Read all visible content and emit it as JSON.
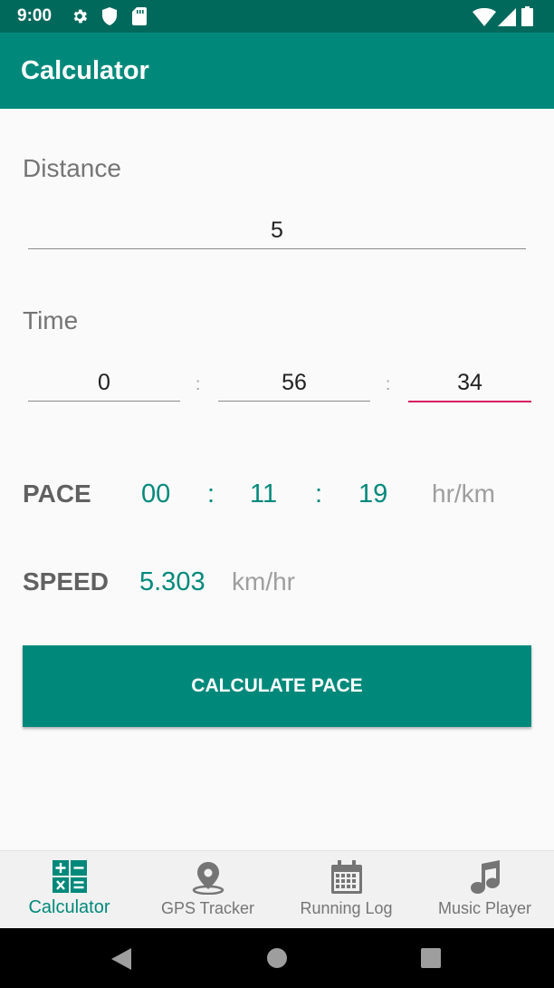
{
  "status_bar": {
    "time": "9:00"
  },
  "app_bar": {
    "title": "Calculator"
  },
  "distance": {
    "label": "Distance",
    "value": "5"
  },
  "time": {
    "label": "Time",
    "hours": "0",
    "minutes": "56",
    "seconds": "34",
    "separator": ":"
  },
  "pace": {
    "label": "PACE",
    "hh": "00",
    "mm": "11",
    "ss": "19",
    "separator": ":",
    "unit": "hr/km"
  },
  "speed": {
    "label": "SPEED",
    "value": "5.303",
    "unit": "km/hr"
  },
  "calculate_button": {
    "label": "CALCULATE PACE"
  },
  "bottom_nav": {
    "items": [
      {
        "label": "Calculator",
        "icon": "calculator-icon",
        "active": true
      },
      {
        "label": "GPS Tracker",
        "icon": "location-pin-icon",
        "active": false
      },
      {
        "label": "Running Log",
        "icon": "calendar-icon",
        "active": false
      },
      {
        "label": "Music Player",
        "icon": "music-note-icon",
        "active": false
      }
    ]
  },
  "colors": {
    "primary": "#00897b",
    "primary_dark": "#00695c",
    "accent": "#d81b60"
  }
}
